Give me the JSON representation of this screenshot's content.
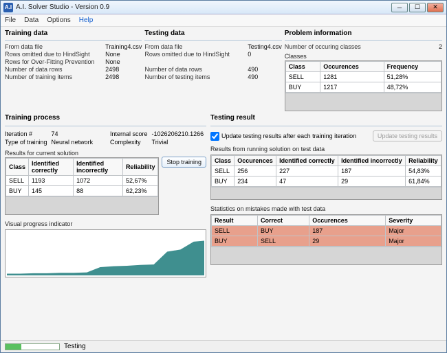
{
  "window": {
    "title": "A.I. Solver Studio - Version 0.9",
    "icon_text": "A.I"
  },
  "menu": {
    "file": "File",
    "data": "Data",
    "options": "Options",
    "help": "Help"
  },
  "training_data": {
    "title": "Training data",
    "from_file_label": "From data file",
    "from_file": "Training4.csv",
    "hindsight_label": "Rows omitted due to HindSight",
    "hindsight": "None",
    "overfit_label": "Rows for Over-Fitting Prevention",
    "overfit": "None",
    "rows_label": "Number of data rows",
    "rows": "2498",
    "items_label": "Number of training items",
    "items": "2498"
  },
  "testing_data": {
    "title": "Testing data",
    "from_file_label": "From data file",
    "from_file": "Testing4.csv",
    "hindsight_label": "Rows omitted due to HindSight",
    "hindsight": "0",
    "rows_label": "Number of data rows",
    "rows": "490",
    "items_label": "Number of testing items",
    "items": "490"
  },
  "problem_info": {
    "title": "Problem information",
    "classes_count_label": "Number of occuring classes",
    "classes_count": "2",
    "classes_label": "Classes",
    "headers": {
      "class": "Class",
      "occ": "Occurences",
      "freq": "Frequency"
    },
    "rows": [
      {
        "class": "SELL",
        "occ": "1281",
        "freq": "51,28%"
      },
      {
        "class": "BUY",
        "occ": "1217",
        "freq": "48,72%"
      }
    ]
  },
  "training_process": {
    "title": "Training process",
    "iter_label": "Iteration #",
    "iter": "74",
    "score_label": "Internal score",
    "score": "-1026206210.1266",
    "type_label": "Type of training",
    "type": "Neural network",
    "complexity_label": "Complexity",
    "complexity": "Trivial",
    "results_label": "Results for current solution",
    "stop_label": "Stop training",
    "headers": {
      "class": "Class",
      "idc": "Identified correctly",
      "idi": "Identified incorrectly",
      "rel": "Reliability"
    },
    "rows": [
      {
        "class": "SELL",
        "idc": "1193",
        "idi": "1072",
        "rel": "52,67%"
      },
      {
        "class": "BUY",
        "idc": "145",
        "idi": "88",
        "rel": "62,23%"
      }
    ],
    "vpi_label": "Visual progress indicator"
  },
  "testing_result": {
    "title": "Testing result",
    "update_check_label": "Update testing results after each training iteration",
    "update_btn": "Update testing results",
    "results_label": "Results from running solution on test data",
    "headers": {
      "class": "Class",
      "occ": "Occurences",
      "idc": "Identified correctly",
      "idi": "Identified incorrectly",
      "rel": "Reliability"
    },
    "rows": [
      {
        "class": "SELL",
        "occ": "256",
        "idc": "227",
        "idi": "187",
        "rel": "54,83%"
      },
      {
        "class": "BUY",
        "occ": "234",
        "idc": "47",
        "idi": "29",
        "rel": "61,84%"
      }
    ],
    "mistakes_label": "Statistics on mistakes made with test data",
    "mistakes_headers": {
      "result": "Result",
      "correct": "Correct",
      "occ": "Occurences",
      "sev": "Severity"
    },
    "mistakes_rows": [
      {
        "result": "SELL",
        "correct": "BUY",
        "occ": "187",
        "sev": "Major"
      },
      {
        "result": "BUY",
        "correct": "SELL",
        "occ": "29",
        "sev": "Major"
      }
    ]
  },
  "status": {
    "text": "Testing"
  },
  "chart_data": {
    "type": "line",
    "title": "Visual progress indicator",
    "xlabel": "",
    "ylabel": "",
    "x": [
      0,
      5,
      10,
      15,
      20,
      25,
      30,
      35,
      40,
      45,
      50,
      55,
      60,
      65,
      70,
      74
    ],
    "values": [
      5,
      5,
      6,
      6,
      7,
      7,
      8,
      20,
      22,
      23,
      25,
      26,
      55,
      60,
      78,
      80
    ],
    "ylim": [
      0,
      100
    ]
  }
}
